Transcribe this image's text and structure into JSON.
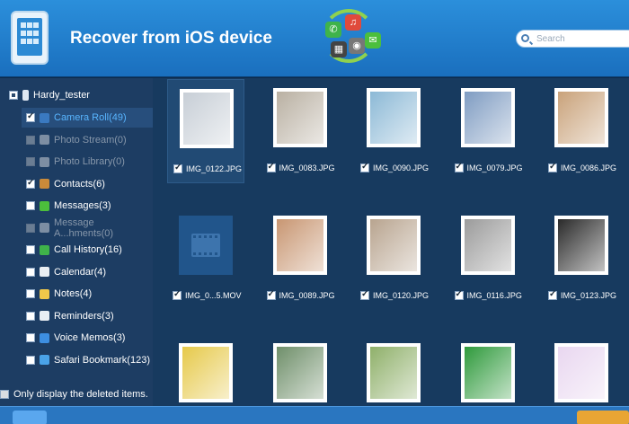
{
  "header": {
    "title": "Recover from iOS device",
    "search_placeholder": "Search",
    "colors": {
      "bar": "#1f7ccc",
      "accent": "#58b5ff"
    }
  },
  "sidebar": {
    "device_name": "Hardy_tester",
    "items": [
      {
        "label": "Camera Roll(49)",
        "checked": true,
        "state": "selected",
        "icon": "camera-roll-icon",
        "icon_color": "#3a79c0"
      },
      {
        "label": "Photo Stream(0)",
        "checked": false,
        "state": "disabled",
        "icon": "photo-stream-icon",
        "icon_color": "#7d8ea3"
      },
      {
        "label": "Photo Library(0)",
        "checked": false,
        "state": "disabled",
        "icon": "photo-library-icon",
        "icon_color": "#7d8ea3"
      },
      {
        "label": "Contacts(6)",
        "checked": true,
        "state": "normal",
        "icon": "contacts-icon",
        "icon_color": "#c98a3a"
      },
      {
        "label": "Messages(3)",
        "checked": false,
        "state": "normal",
        "icon": "messages-icon",
        "icon_color": "#4cbf3c"
      },
      {
        "label": "Message A...hments(0)",
        "checked": false,
        "state": "disabled",
        "icon": "message-attachments-icon",
        "icon_color": "#7d8ea3"
      },
      {
        "label": "Call History(16)",
        "checked": false,
        "state": "normal",
        "icon": "call-history-icon",
        "icon_color": "#3fb34a"
      },
      {
        "label": "Calendar(4)",
        "checked": false,
        "state": "normal",
        "icon": "calendar-icon",
        "icon_color": "#e9eef3"
      },
      {
        "label": "Notes(4)",
        "checked": false,
        "state": "normal",
        "icon": "notes-icon",
        "icon_color": "#f0c84a"
      },
      {
        "label": "Reminders(3)",
        "checked": false,
        "state": "normal",
        "icon": "reminders-icon",
        "icon_color": "#e9eef3"
      },
      {
        "label": "Voice Memos(3)",
        "checked": false,
        "state": "normal",
        "icon": "voice-memos-icon",
        "icon_color": "#3d8ee0"
      },
      {
        "label": "Safari Bookmark(123)",
        "checked": false,
        "state": "normal",
        "icon": "safari-bookmark-icon",
        "icon_color": "#4aa3e8"
      }
    ],
    "footer_label": "Only display the deleted items."
  },
  "files": [
    {
      "name": "IMG_0122.JPG",
      "checked": true,
      "selected": true,
      "kind": "photo",
      "tone": "#c7ced6"
    },
    {
      "name": "IMG_0083.JPG",
      "checked": true,
      "selected": false,
      "kind": "photo",
      "tone": "#b9b0a2"
    },
    {
      "name": "IMG_0090.JPG",
      "checked": true,
      "selected": false,
      "kind": "photo",
      "tone": "#8cb9d6"
    },
    {
      "name": "IMG_0079.JPG",
      "checked": true,
      "selected": false,
      "kind": "photo",
      "tone": "#7f9cc2"
    },
    {
      "name": "IMG_0086.JPG",
      "checked": true,
      "selected": false,
      "kind": "photo",
      "tone": "#c9a27a"
    },
    {
      "name": "IMG_0...5.MOV",
      "checked": true,
      "selected": false,
      "kind": "video",
      "tone": "#21558b"
    },
    {
      "name": "IMG_0089.JPG",
      "checked": true,
      "selected": false,
      "kind": "photo",
      "tone": "#c89672"
    },
    {
      "name": "IMG_0120.JPG",
      "checked": true,
      "selected": false,
      "kind": "photo",
      "tone": "#b8a48f"
    },
    {
      "name": "IMG_0116.JPG",
      "checked": true,
      "selected": false,
      "kind": "photo",
      "tone": "#9b9b9b"
    },
    {
      "name": "IMG_0123.JPG",
      "checked": true,
      "selected": false,
      "kind": "photo",
      "tone": "#2a2a2a"
    },
    {
      "name": "",
      "checked": false,
      "selected": false,
      "kind": "photo",
      "tone": "#e6c94a"
    },
    {
      "name": "",
      "checked": false,
      "selected": false,
      "kind": "photo",
      "tone": "#6f8f6a"
    },
    {
      "name": "",
      "checked": false,
      "selected": false,
      "kind": "photo",
      "tone": "#8fb06a"
    },
    {
      "name": "",
      "checked": false,
      "selected": false,
      "kind": "photo",
      "tone": "#2f9a3c"
    },
    {
      "name": "",
      "checked": false,
      "selected": false,
      "kind": "photo",
      "tone": "#e9d7f0"
    }
  ]
}
